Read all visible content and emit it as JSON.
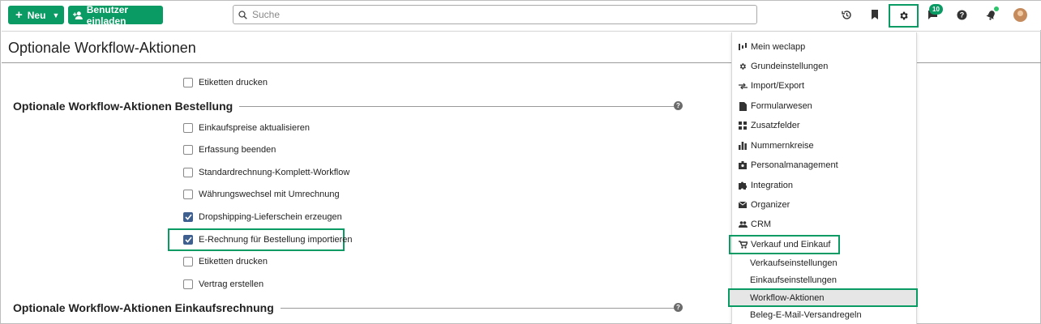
{
  "toolbar": {
    "new_label": "Neu",
    "invite_label": "Benutzer einladen",
    "search_placeholder": "Suche",
    "chat_badge": "10"
  },
  "page": {
    "title": "Optionale Workflow-Aktionen"
  },
  "content": {
    "top_item": {
      "label": "Etiketten drucken",
      "checked": false
    },
    "section_bestellung": "Optionale Workflow-Aktionen Bestellung",
    "bestellung_items": [
      {
        "label": "Einkaufspreise aktualisieren",
        "checked": false
      },
      {
        "label": "Erfassung beenden",
        "checked": false
      },
      {
        "label": "Standardrechnung-Komplett-Workflow",
        "checked": false
      },
      {
        "label": "Währungswechsel mit Umrechnung",
        "checked": false
      },
      {
        "label": "Dropshipping-Lieferschein erzeugen",
        "checked": true
      },
      {
        "label": "E-Rechnung für Bestellung importieren",
        "checked": true
      },
      {
        "label": "Etiketten drucken",
        "checked": false
      },
      {
        "label": "Vertrag erstellen",
        "checked": false
      }
    ],
    "section_einkaufsrechnung": "Optionale Workflow-Aktionen Einkaufsrechnung"
  },
  "menu": {
    "items": [
      {
        "label": "Mein weclapp",
        "icon": "dashboard-icon"
      },
      {
        "label": "Grundeinstellungen",
        "icon": "gear-icon"
      },
      {
        "label": "Import/Export",
        "icon": "import-export-icon"
      },
      {
        "label": "Formularwesen",
        "icon": "document-icon"
      },
      {
        "label": "Zusatzfelder",
        "icon": "fields-icon"
      },
      {
        "label": "Nummernkreise",
        "icon": "bar-chart-icon"
      },
      {
        "label": "Personalmanagement",
        "icon": "id-badge-icon"
      },
      {
        "label": "Integration",
        "icon": "puzzle-icon"
      },
      {
        "label": "Organizer",
        "icon": "mail-icon"
      },
      {
        "label": "CRM",
        "icon": "users-icon"
      },
      {
        "label": "Verkauf und Einkauf",
        "icon": "cart-icon"
      }
    ],
    "sub_items": [
      "Verkaufseinstellungen",
      "Einkaufseinstellungen",
      "Workflow-Aktionen",
      "Beleg-E-Mail-Versandregeln"
    ]
  },
  "colors": {
    "brand_green": "#0a9a63",
    "checkbox_checked": "#3f5f8f"
  }
}
